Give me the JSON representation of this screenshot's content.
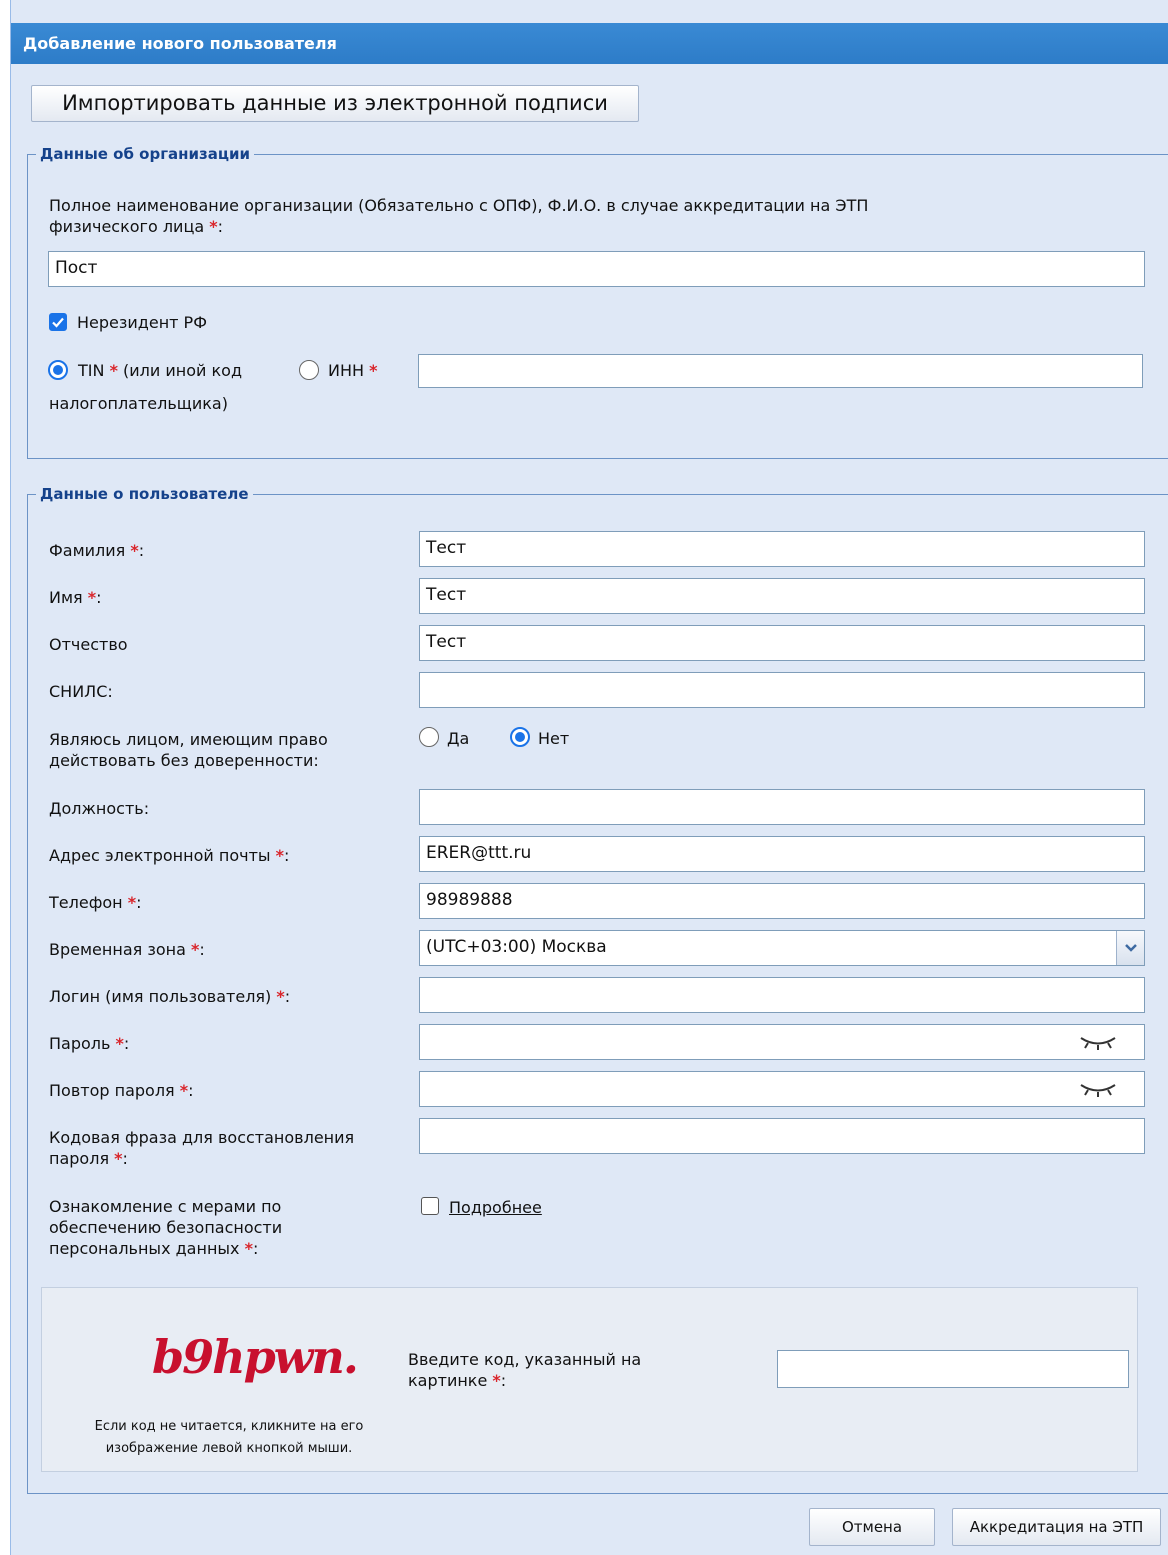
{
  "window": {
    "title": "Добавление нового пользователя"
  },
  "import_button": {
    "label": "Импортировать данные из электронной подписи"
  },
  "org": {
    "legend": "Данные об организации",
    "full_name_label": "Полное наименование организации (Обязательно с ОПФ), Ф.И.О. в случае аккредитации на ЭТП",
    "full_name_label_2": "физического лица",
    "full_name_value": "Пост",
    "nonresident_label": "Нерезидент РФ",
    "nonresident_checked": true,
    "tin_label": "TIN",
    "tin_hint_1": "(или иной код",
    "tin_hint_2": "налогоплательщика)",
    "inn_label": "ИНН",
    "tax_code_value": ""
  },
  "user": {
    "legend": "Данные о пользователе",
    "fields": {
      "last_name": {
        "label": "Фамилия",
        "value": "Тест"
      },
      "first_name": {
        "label": "Имя",
        "value": "Тест"
      },
      "patronymic": {
        "label": "Отчество",
        "value": "Тест"
      },
      "snils": {
        "label": "СНИЛС:",
        "value": ""
      },
      "authority_label_1": "Являюсь лицом, имеющим право",
      "authority_label_2": "действовать без доверенности:",
      "authority_yes": "Да",
      "authority_no": "Нет",
      "position": {
        "label": "Должность:",
        "value": ""
      },
      "email": {
        "label": "Адрес электронной почты",
        "value": "ERER@ttt.ru"
      },
      "phone": {
        "label": "Телефон",
        "value": "98989888"
      },
      "timezone": {
        "label": "Временная зона",
        "value": "(UTC+03:00) Москва"
      },
      "login": {
        "label": "Логин (имя пользователя)",
        "value": ""
      },
      "password": {
        "label": "Пароль",
        "value": ""
      },
      "password_repeat": {
        "label": "Повтор пароля",
        "value": ""
      },
      "code_phrase_label_1": "Кодовая фраза для восстановления",
      "code_phrase_label_2": "пароля",
      "code_phrase_value": "",
      "privacy_label_1": "Ознакомление с мерами по",
      "privacy_label_2": "обеспечению безопасности",
      "privacy_label_3": "персональных данных",
      "privacy_link": "Подробнее"
    }
  },
  "captcha": {
    "image_text": "b9hpwn.",
    "prompt_1": "Введите код, указанный на",
    "prompt_2": "картинке",
    "note_1": "Если код не читается, кликните на его",
    "note_2": "изображение левой кнопкой мыши.",
    "value": ""
  },
  "buttons": {
    "cancel": "Отмена",
    "accredit": "Аккредитация на ЭТП"
  },
  "required_mark": "*",
  "colors": {
    "title_bar": "#2d7cc8",
    "background": "#dfe8f6",
    "required": "#d9262c",
    "accent": "#1a73e8"
  }
}
